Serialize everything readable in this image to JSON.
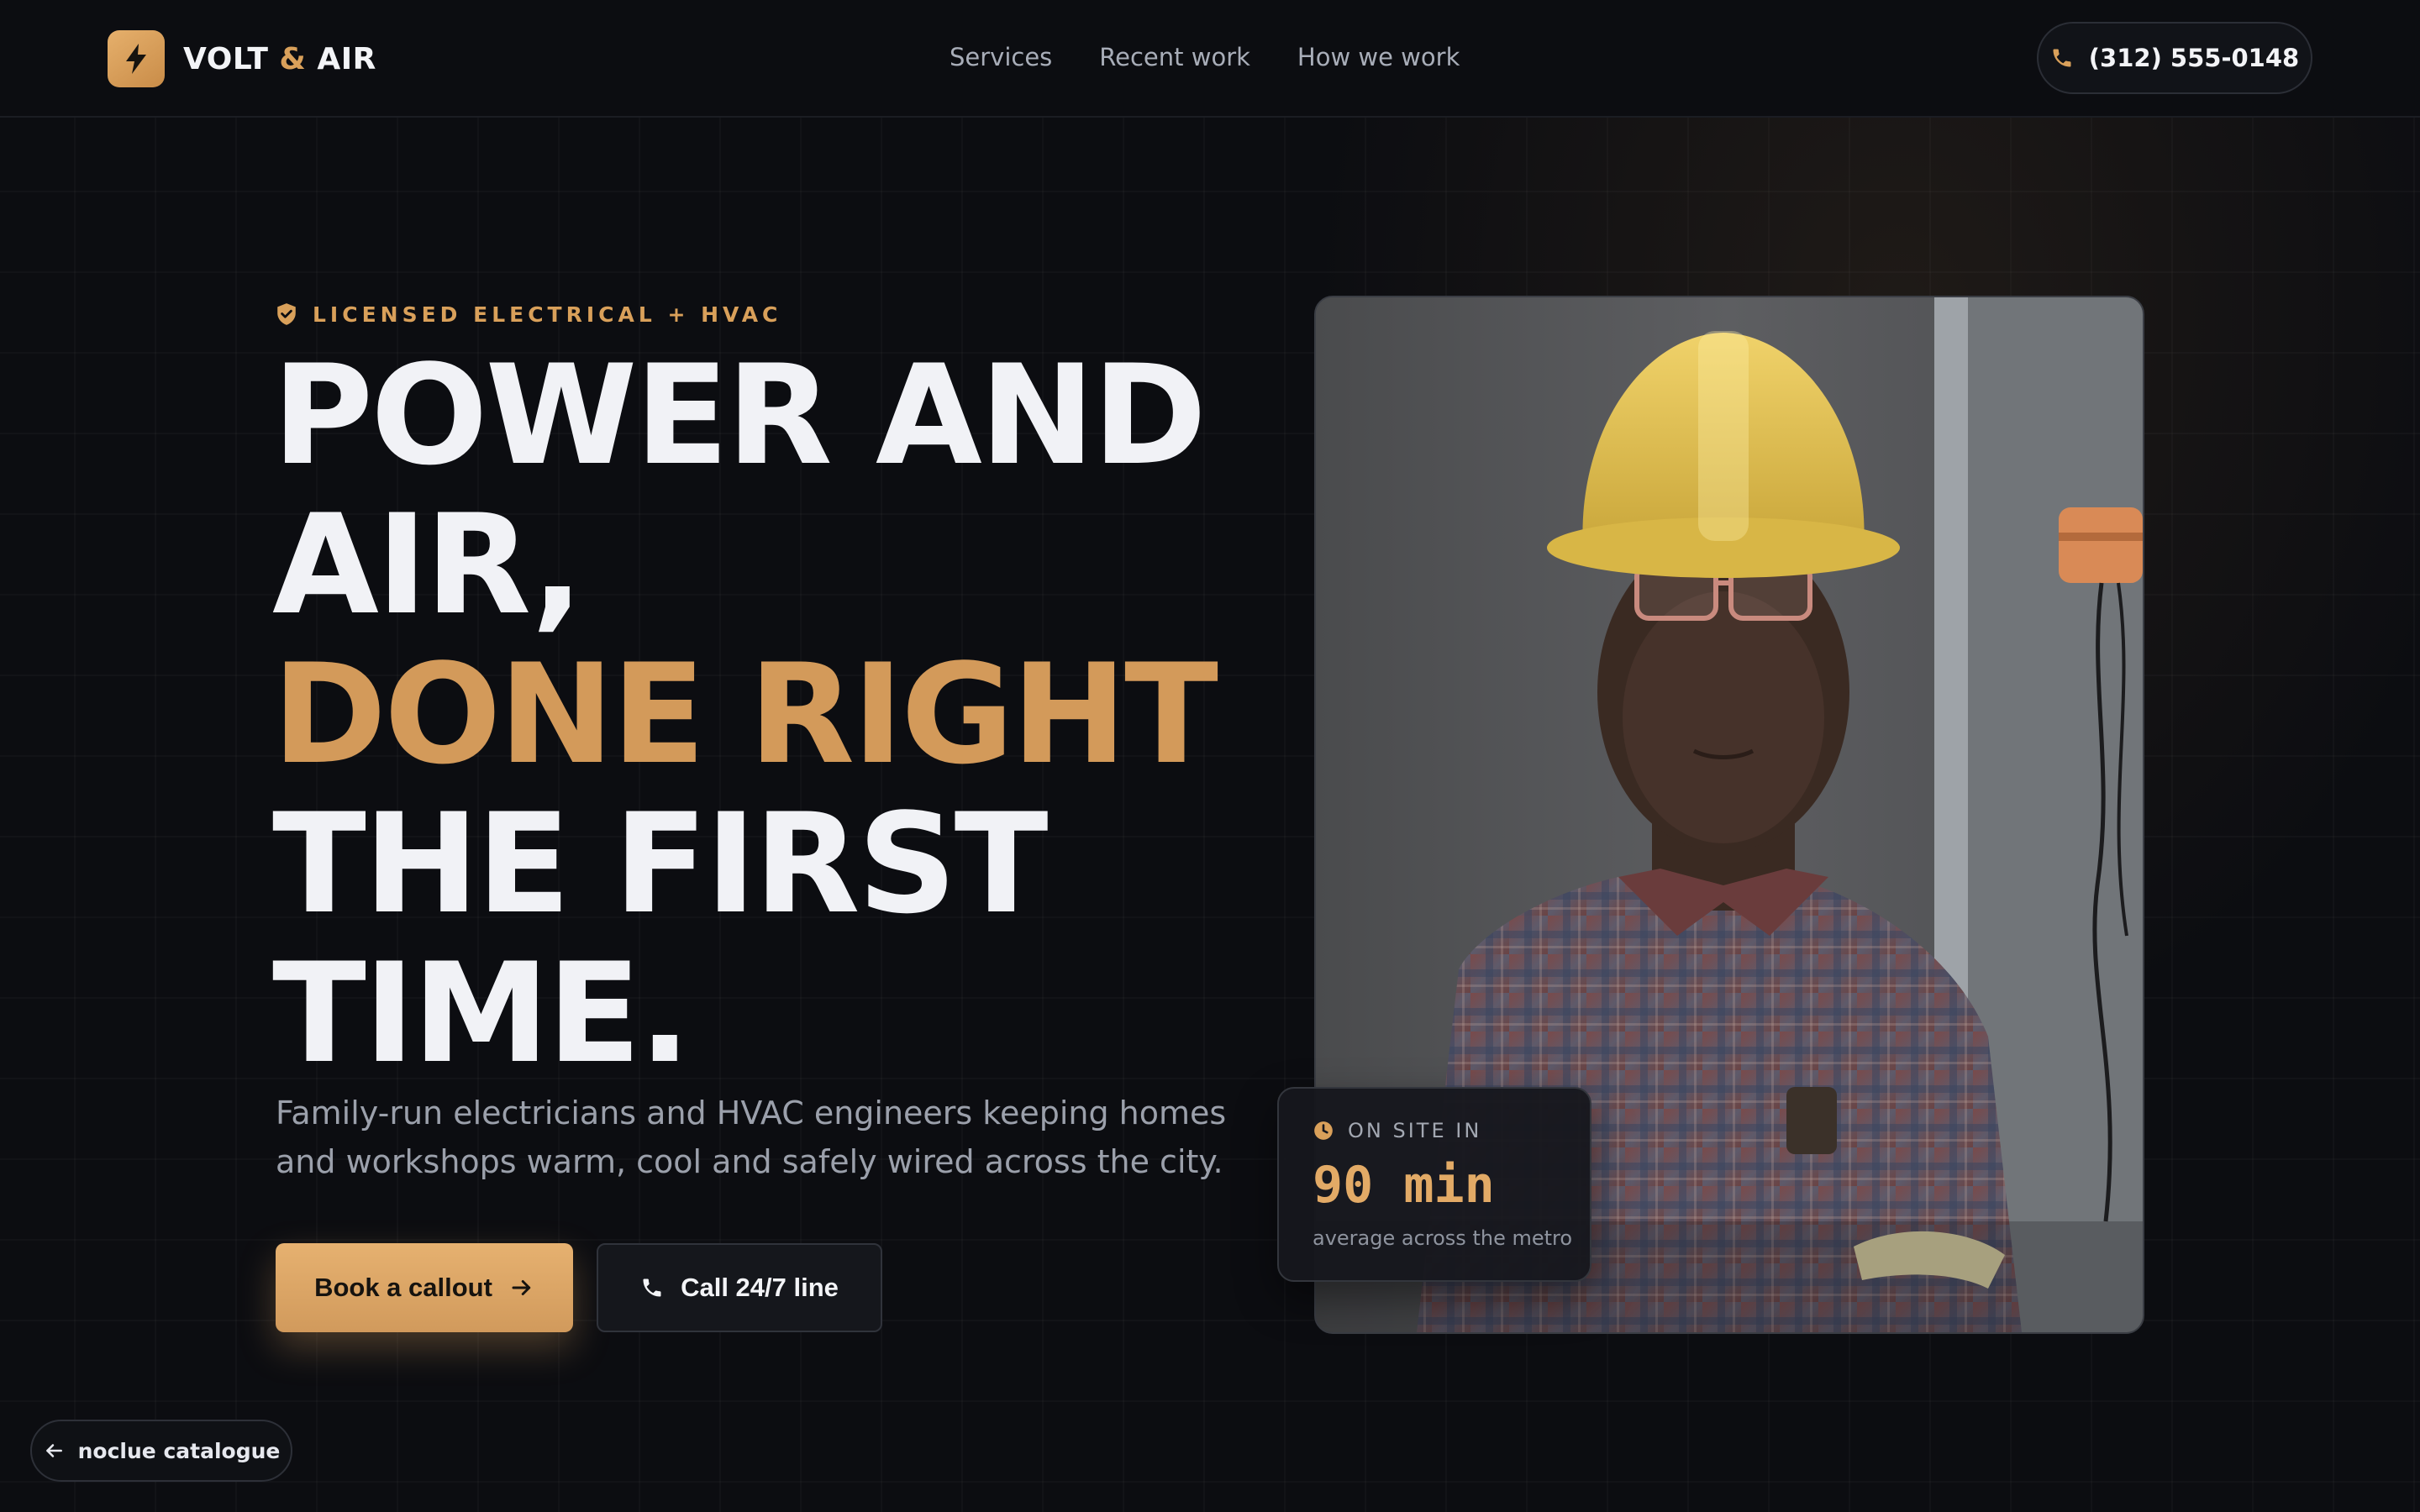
{
  "brand": {
    "name_part1": "VOLT",
    "ampersand": "&",
    "name_part2": "AIR",
    "icon": "lightning-bolt-icon"
  },
  "nav": {
    "items": [
      "Services",
      "Recent work",
      "How we work"
    ]
  },
  "header": {
    "phone": "(312) 555-0148",
    "phone_icon": "phone-icon"
  },
  "hero": {
    "eyebrow": "LICENSED ELECTRICAL + HVAC",
    "eyebrow_icon": "shield-check-icon",
    "headline": {
      "line1": "POWER AND",
      "line2": "AIR,",
      "line3_accent": "DONE RIGHT",
      "line4": "THE FIRST",
      "line5": "TIME."
    },
    "subtext": "Family-run electricians and HVAC engineers keeping homes and workshops warm, cool and safely wired across the city.",
    "primary_button": "Book a callout",
    "primary_button_icon": "arrow-right-icon",
    "secondary_button": "Call 24/7 line",
    "secondary_button_icon": "phone-icon"
  },
  "stat": {
    "label": "ON SITE IN",
    "icon": "clock-icon",
    "value": "90 min",
    "caption": "average across the metro"
  },
  "back_link": {
    "label": "noclue catalogue",
    "icon": "arrow-left-icon"
  },
  "colors": {
    "background": "#0c0d11",
    "accent": "#d39a5a",
    "text": "#f1f2f6",
    "muted": "#9ba0ab"
  }
}
